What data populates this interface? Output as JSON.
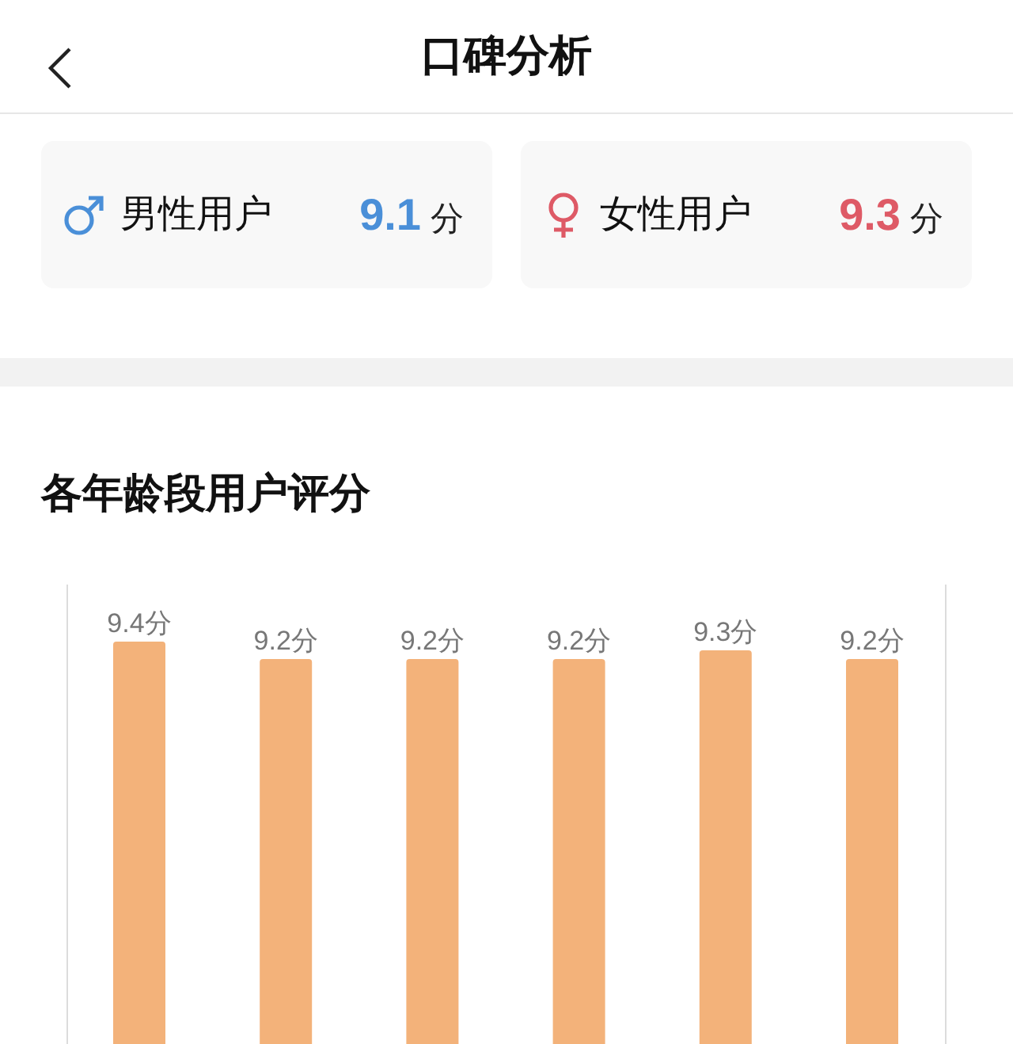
{
  "header": {
    "title": "口碑分析"
  },
  "gender_scores": [
    {
      "kind": "male",
      "label": "男性用户",
      "score": "9.1",
      "unit": "分",
      "color": "#4a8fd8"
    },
    {
      "kind": "female",
      "label": "女性用户",
      "score": "9.3",
      "unit": "分",
      "color": "#de5a66"
    }
  ],
  "age_section": {
    "title": "各年龄段用户评分",
    "chart_data": {
      "type": "bar",
      "values": [
        9.4,
        9.2,
        9.2,
        9.2,
        9.3,
        9.2
      ],
      "value_labels": [
        "9.4分",
        "9.2分",
        "9.2分",
        "9.2分",
        "9.3分",
        "9.2分"
      ],
      "color": "#f3b27a"
    }
  }
}
